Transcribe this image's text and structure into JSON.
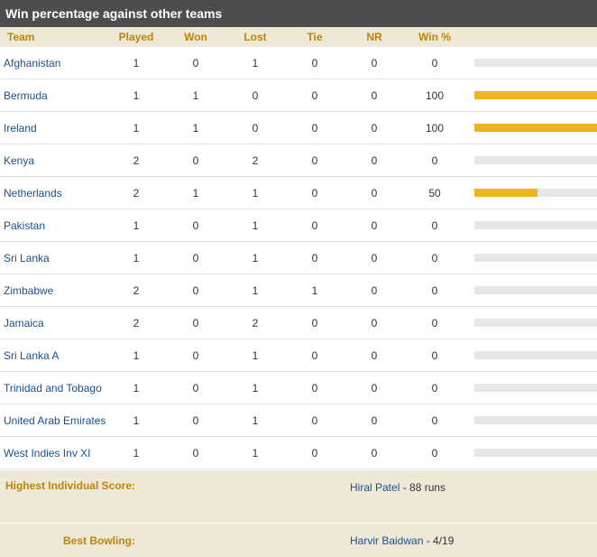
{
  "title": "Win percentage against other teams",
  "colors": {
    "bar_fill": "#f0b323",
    "bar_track": "#e6e6e6",
    "header_text": "#b8860b",
    "link": "#1a4f91"
  },
  "columns": {
    "team": "Team",
    "played": "Played",
    "won": "Won",
    "lost": "Lost",
    "tie": "Tie",
    "nr": "NR",
    "win_pct": "Win %"
  },
  "rows": [
    {
      "team": "Afghanistan",
      "played": "1",
      "won": "0",
      "lost": "1",
      "tie": "0",
      "nr": "0",
      "win_pct": "0",
      "win_value": 0
    },
    {
      "team": "Bermuda",
      "played": "1",
      "won": "1",
      "lost": "0",
      "tie": "0",
      "nr": "0",
      "win_pct": "100",
      "win_value": 100
    },
    {
      "team": "Ireland",
      "played": "1",
      "won": "1",
      "lost": "0",
      "tie": "0",
      "nr": "0",
      "win_pct": "100",
      "win_value": 100
    },
    {
      "team": "Kenya",
      "played": "2",
      "won": "0",
      "lost": "2",
      "tie": "0",
      "nr": "0",
      "win_pct": "0",
      "win_value": 0
    },
    {
      "team": "Netherlands",
      "played": "2",
      "won": "1",
      "lost": "1",
      "tie": "0",
      "nr": "0",
      "win_pct": "50",
      "win_value": 50
    },
    {
      "team": "Pakistan",
      "played": "1",
      "won": "0",
      "lost": "1",
      "tie": "0",
      "nr": "0",
      "win_pct": "0",
      "win_value": 0
    },
    {
      "team": "Sri Lanka",
      "played": "1",
      "won": "0",
      "lost": "1",
      "tie": "0",
      "nr": "0",
      "win_pct": "0",
      "win_value": 0
    },
    {
      "team": "Zimbabwe",
      "played": "2",
      "won": "0",
      "lost": "1",
      "tie": "1",
      "nr": "0",
      "win_pct": "0",
      "win_value": 0
    },
    {
      "team": "Jamaica",
      "played": "2",
      "won": "0",
      "lost": "2",
      "tie": "0",
      "nr": "0",
      "win_pct": "0",
      "win_value": 0
    },
    {
      "team": "Sri Lanka A",
      "played": "1",
      "won": "0",
      "lost": "1",
      "tie": "0",
      "nr": "0",
      "win_pct": "0",
      "win_value": 0
    },
    {
      "team": "Trinidad and Tobago",
      "played": "1",
      "won": "0",
      "lost": "1",
      "tie": "0",
      "nr": "0",
      "win_pct": "0",
      "win_value": 0
    },
    {
      "team": "United Arab Emirates",
      "played": "1",
      "won": "0",
      "lost": "1",
      "tie": "0",
      "nr": "0",
      "win_pct": "0",
      "win_value": 0
    },
    {
      "team": "West Indies Inv XI",
      "played": "1",
      "won": "0",
      "lost": "1",
      "tie": "0",
      "nr": "0",
      "win_pct": "0",
      "win_value": 0
    }
  ],
  "highest_score": {
    "label": "Highest Individual Score:",
    "player": "Hiral Patel",
    "detail": " - 88 runs"
  },
  "best_bowling": {
    "label": "Best Bowling:",
    "player": "Harvir Baidwan",
    "detail": " - 4/19"
  }
}
